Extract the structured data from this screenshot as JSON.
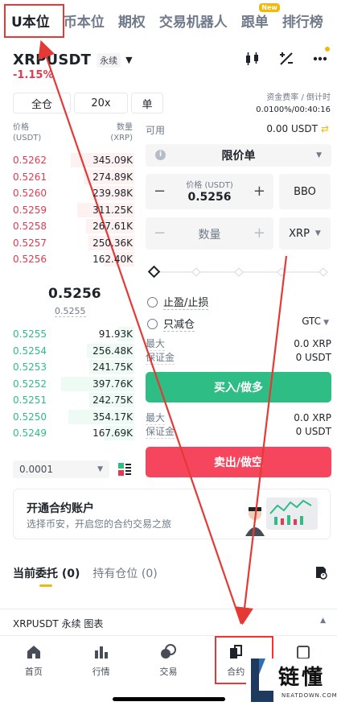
{
  "top_tabs": [
    {
      "label": "U本位",
      "active": true
    },
    {
      "label": "币本位",
      "active": false
    },
    {
      "label": "期权",
      "active": false
    },
    {
      "label": "交易机器人",
      "active": false
    },
    {
      "label": "跟单",
      "active": false,
      "badge": "New"
    },
    {
      "label": "排行榜",
      "active": false
    }
  ],
  "header": {
    "symbol": "XRPUSDT",
    "contract_type": "永续",
    "change_pct": "-1.15%",
    "icons": [
      "candlestick-icon",
      "percent-adjust-icon",
      "more-icon"
    ]
  },
  "margin": {
    "mode": "全仓",
    "leverage": "20x",
    "position_mode": "单"
  },
  "funding": {
    "label": "资金费率 / 倒计时",
    "value": "0.0100%/00:40:16"
  },
  "orderbook": {
    "price_label": "价格",
    "price_unit": "(USDT)",
    "qty_label": "数量",
    "qty_unit": "(XRP)",
    "asks": [
      {
        "price": "0.5262",
        "qty": "345.09K",
        "depth": 0.52
      },
      {
        "price": "0.5261",
        "qty": "274.89K",
        "depth": 0.42
      },
      {
        "price": "0.5260",
        "qty": "239.98K",
        "depth": 0.36
      },
      {
        "price": "0.5259",
        "qty": "311.25K",
        "depth": 0.47
      },
      {
        "price": "0.5258",
        "qty": "267.61K",
        "depth": 0.4
      },
      {
        "price": "0.5257",
        "qty": "250.36K",
        "depth": 0.38
      },
      {
        "price": "0.5256",
        "qty": "162.40K",
        "depth": 0.25
      }
    ],
    "last_price": "0.5256",
    "mark_price": "0.5255",
    "bids": [
      {
        "price": "0.5255",
        "qty": "91.93K",
        "depth": 0.14
      },
      {
        "price": "0.5254",
        "qty": "256.48K",
        "depth": 0.39
      },
      {
        "price": "0.5253",
        "qty": "241.75K",
        "depth": 0.37
      },
      {
        "price": "0.5252",
        "qty": "397.76K",
        "depth": 0.6
      },
      {
        "price": "0.5251",
        "qty": "242.75K",
        "depth": 0.37
      },
      {
        "price": "0.5250",
        "qty": "354.17K",
        "depth": 0.54
      },
      {
        "price": "0.5249",
        "qty": "167.69K",
        "depth": 0.25
      }
    ],
    "precision": "0.0001"
  },
  "form": {
    "available_label": "可用",
    "available_value": "0.00 USDT",
    "order_type": "限价单",
    "price_label": "价格 (USDT)",
    "price_value": "0.5256",
    "bbo_label": "BBO",
    "qty_placeholder": "数量",
    "qty_unit": "XRP",
    "tp_sl_label": "止盈/止损",
    "reduce_only_label": "只减仓",
    "tif": "GTC",
    "buy_max_label": "最大",
    "buy_max_value": "0.0 XRP",
    "buy_margin_label": "保证金",
    "buy_margin_value": "0 USDT",
    "buy_button": "买入/做多",
    "sell_max_label": "最大",
    "sell_max_value": "0.0 XRP",
    "sell_margin_label": "保证金",
    "sell_margin_value": "0 USDT",
    "sell_button": "卖出/做空"
  },
  "promo": {
    "title": "开通合约账户",
    "subtitle": "选择币安，开启您的合约交易之旅"
  },
  "order_tabs": [
    {
      "label": "当前委托 (0)",
      "active": true
    },
    {
      "label": "持有仓位 (0)",
      "active": false
    }
  ],
  "chart_bar": {
    "label": "XRPUSDT 永续  图表"
  },
  "bottom_nav": [
    {
      "label": "首页",
      "icon": "home-icon"
    },
    {
      "label": "行情",
      "icon": "markets-icon"
    },
    {
      "label": "交易",
      "icon": "trade-icon"
    },
    {
      "label": "合约",
      "icon": "futures-icon"
    },
    {
      "label": "",
      "icon": "wallet-icon"
    }
  ],
  "watermark": {
    "cn": "链懂",
    "en": "NEATDOWN.COM"
  },
  "colors": {
    "ask": "#e53950",
    "bid": "#2ebd85",
    "accent": "#f0b90b",
    "annotation": "#e53935"
  }
}
